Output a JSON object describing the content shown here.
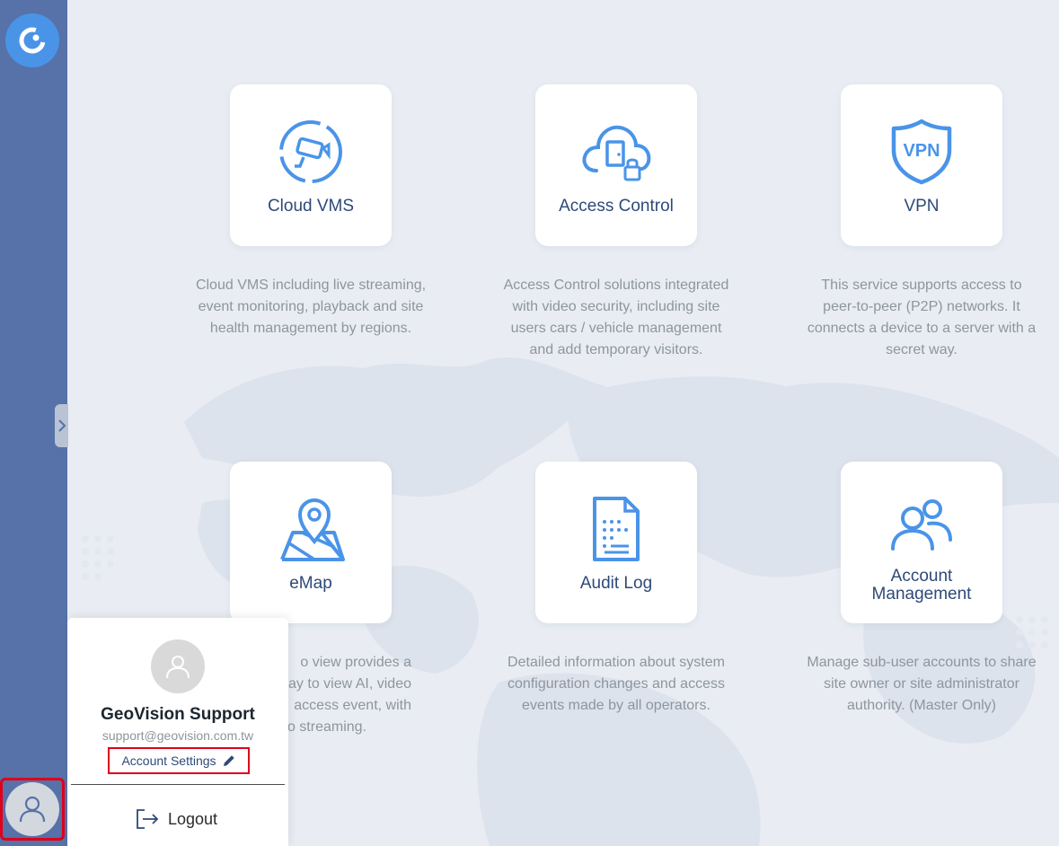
{
  "sidebar": {
    "logo_icon": "app-logo-icon",
    "collapse_icon": "chevron-right-icon",
    "account_icon": "user-icon"
  },
  "services": [
    {
      "title": "Cloud VMS",
      "icon": "cloud-camera-icon",
      "description": "Cloud VMS including live streaming, event monitoring, playback and site health management by regions."
    },
    {
      "title": "Access Control",
      "icon": "cloud-door-lock-icon",
      "description": "Access Control solutions integrated with video security, including site users cars / vehicle management and add temporary visitors."
    },
    {
      "title": "VPN",
      "icon": "vpn-shield-icon",
      "description": "This service supports access to peer-to-peer (P2P) networks. It connects a device to a server with a secret way."
    },
    {
      "title": "eMap",
      "icon": "map-pin-icon",
      "description_lines": [
        "o view provides a",
        "ay to view AI, video",
        "access event, with",
        "o streaming."
      ]
    },
    {
      "title": "Audit Log",
      "icon": "document-list-icon",
      "description": "Detailed information about system configuration changes and access events made by all operators."
    },
    {
      "title_line1": "Account",
      "title_line2": "Management",
      "icon": "users-icon",
      "description": "Manage sub-user accounts to share site owner or site administrator authority. (Master Only)"
    }
  ],
  "account_popup": {
    "name": "GeoVision Support",
    "email": "support@geovision.com.tw",
    "settings_label": "Account Settings",
    "logout_label": "Logout"
  },
  "colors": {
    "sidebar": "#5672a8",
    "accent": "#4a94e8",
    "title": "#2e4a78",
    "highlight": "#e0001a"
  }
}
